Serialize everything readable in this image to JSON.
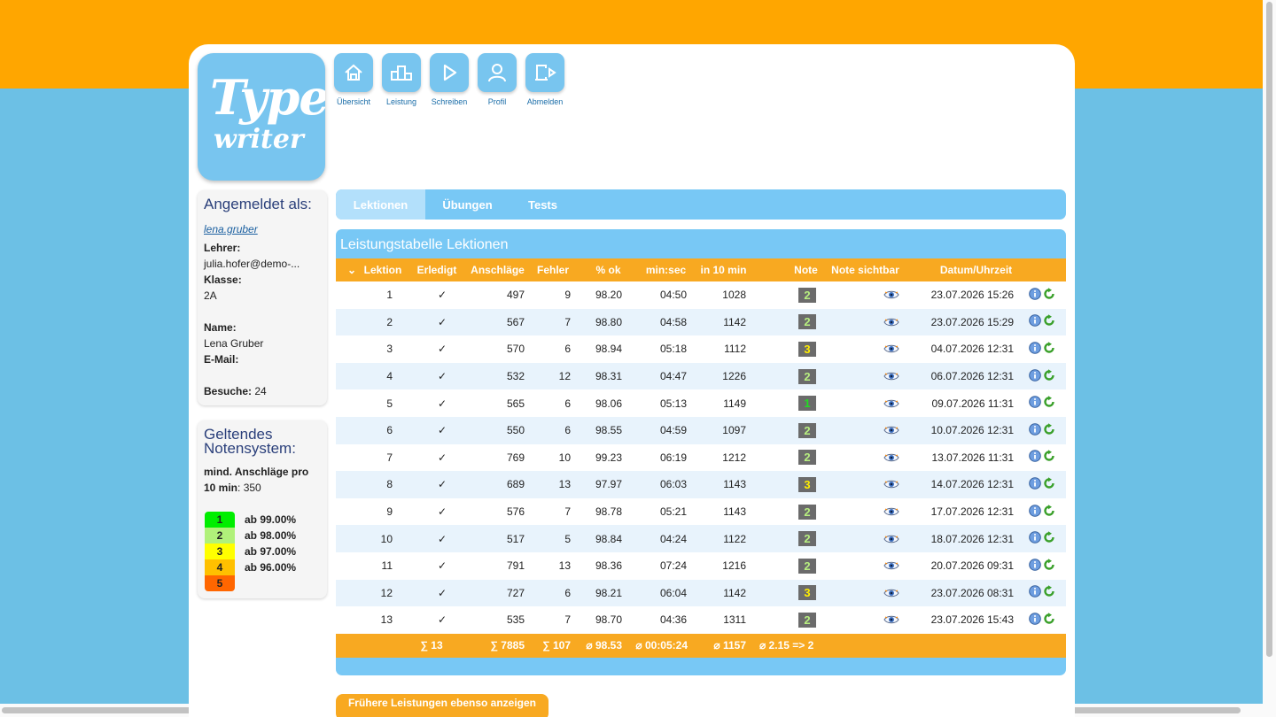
{
  "app": {
    "logo_line1": "Type",
    "logo_line2": "writer"
  },
  "nav": [
    {
      "label": "Übersicht",
      "icon": "home-icon"
    },
    {
      "label": "Leistung",
      "icon": "podium-icon"
    },
    {
      "label": "Schreiben",
      "icon": "play-icon"
    },
    {
      "label": "Profil",
      "icon": "user-icon"
    },
    {
      "label": "Abmelden",
      "icon": "logout-icon"
    }
  ],
  "user_box": {
    "title": "Angemeldet als:",
    "username": "lena.gruber",
    "teacher_label": "Lehrer:",
    "teacher_value": "julia.hofer@demo-...",
    "class_label": "Klasse:",
    "class_value": "2A",
    "name_label": "Name:",
    "name_value": "Lena Gruber",
    "email_label": "E-Mail:",
    "visits_label": "Besuche:",
    "visits_value": "24"
  },
  "grading_box": {
    "title_line1": "Geltendes",
    "title_line2": "Notensystem:",
    "min_label_1": "mind. Anschläge pro",
    "min_label_2": "10 min",
    "min_value": "350",
    "grades": [
      {
        "grade": "1",
        "text": "ab 99.00%",
        "color": "#00ee00"
      },
      {
        "grade": "2",
        "text": "ab 98.00%",
        "color": "#b0f17a"
      },
      {
        "grade": "3",
        "text": "ab 97.00%",
        "color": "#ffff00"
      },
      {
        "grade": "4",
        "text": "ab 96.00%",
        "color": "#ffc000"
      },
      {
        "grade": "5",
        "text": "",
        "color": "#ff6600"
      }
    ]
  },
  "tabs": [
    "Lektionen",
    "Übungen",
    "Tests"
  ],
  "panel": {
    "title": "Leistungstabelle Lektionen"
  },
  "table": {
    "headers": {
      "sort": "⌄",
      "lektion": "Lektion",
      "erledigt": "Erledigt",
      "anschlaege": "Anschläge",
      "fehler": "Fehler",
      "pct": "% ok",
      "time": "min:sec",
      "in10": "in 10 min",
      "note": "Note",
      "sichtbar": "Note sichtbar",
      "datum": "Datum/Uhrzeit"
    },
    "rows": [
      {
        "lektion": "1",
        "erledigt": "✓",
        "anschlaege": "497",
        "fehler": "9",
        "pct": "98.20",
        "time": "04:50",
        "in10": "1028",
        "note": "2",
        "datum": "23.07.2026 15:26"
      },
      {
        "lektion": "2",
        "erledigt": "✓",
        "anschlaege": "567",
        "fehler": "7",
        "pct": "98.80",
        "time": "04:58",
        "in10": "1142",
        "note": "2",
        "datum": "23.07.2026 15:29"
      },
      {
        "lektion": "3",
        "erledigt": "✓",
        "anschlaege": "570",
        "fehler": "6",
        "pct": "98.94",
        "time": "05:18",
        "in10": "1112",
        "note": "3",
        "datum": "04.07.2026 12:31"
      },
      {
        "lektion": "4",
        "erledigt": "✓",
        "anschlaege": "532",
        "fehler": "12",
        "pct": "98.31",
        "time": "04:47",
        "in10": "1226",
        "note": "2",
        "datum": "06.07.2026 12:31"
      },
      {
        "lektion": "5",
        "erledigt": "✓",
        "anschlaege": "565",
        "fehler": "6",
        "pct": "98.06",
        "time": "05:13",
        "in10": "1149",
        "note": "1",
        "datum": "09.07.2026 11:31"
      },
      {
        "lektion": "6",
        "erledigt": "✓",
        "anschlaege": "550",
        "fehler": "6",
        "pct": "98.55",
        "time": "04:59",
        "in10": "1097",
        "note": "2",
        "datum": "10.07.2026 12:31"
      },
      {
        "lektion": "7",
        "erledigt": "✓",
        "anschlaege": "769",
        "fehler": "10",
        "pct": "99.23",
        "time": "06:19",
        "in10": "1212",
        "note": "2",
        "datum": "13.07.2026 11:31"
      },
      {
        "lektion": "8",
        "erledigt": "✓",
        "anschlaege": "689",
        "fehler": "13",
        "pct": "97.97",
        "time": "06:03",
        "in10": "1143",
        "note": "3",
        "datum": "14.07.2026 12:31"
      },
      {
        "lektion": "9",
        "erledigt": "✓",
        "anschlaege": "576",
        "fehler": "7",
        "pct": "98.78",
        "time": "05:21",
        "in10": "1143",
        "note": "2",
        "datum": "17.07.2026 12:31"
      },
      {
        "lektion": "10",
        "erledigt": "✓",
        "anschlaege": "517",
        "fehler": "5",
        "pct": "98.84",
        "time": "04:24",
        "in10": "1122",
        "note": "2",
        "datum": "18.07.2026 12:31"
      },
      {
        "lektion": "11",
        "erledigt": "✓",
        "anschlaege": "791",
        "fehler": "13",
        "pct": "98.36",
        "time": "07:24",
        "in10": "1216",
        "note": "2",
        "datum": "20.07.2026 09:31"
      },
      {
        "lektion": "12",
        "erledigt": "✓",
        "anschlaege": "727",
        "fehler": "6",
        "pct": "98.21",
        "time": "06:04",
        "in10": "1142",
        "note": "3",
        "datum": "23.07.2026 08:31"
      },
      {
        "lektion": "13",
        "erledigt": "✓",
        "anschlaege": "535",
        "fehler": "7",
        "pct": "98.70",
        "time": "04:36",
        "in10": "1311",
        "note": "2",
        "datum": "23.07.2026 15:43"
      }
    ],
    "footer": {
      "erledigt": "∑ 13",
      "anschlaege": "∑ 7885",
      "fehler": "∑ 107",
      "pct": "⌀ 98.53",
      "time": "⌀ 00:05:24",
      "in10": "⌀ 1157",
      "note": "⌀ 2.15 => 2"
    }
  },
  "note_colors": {
    "1": "#22dd22",
    "2": "#b8f080",
    "3": "#ffee00"
  },
  "older_button": "Frühere Leistungen ebenso anzeigen"
}
